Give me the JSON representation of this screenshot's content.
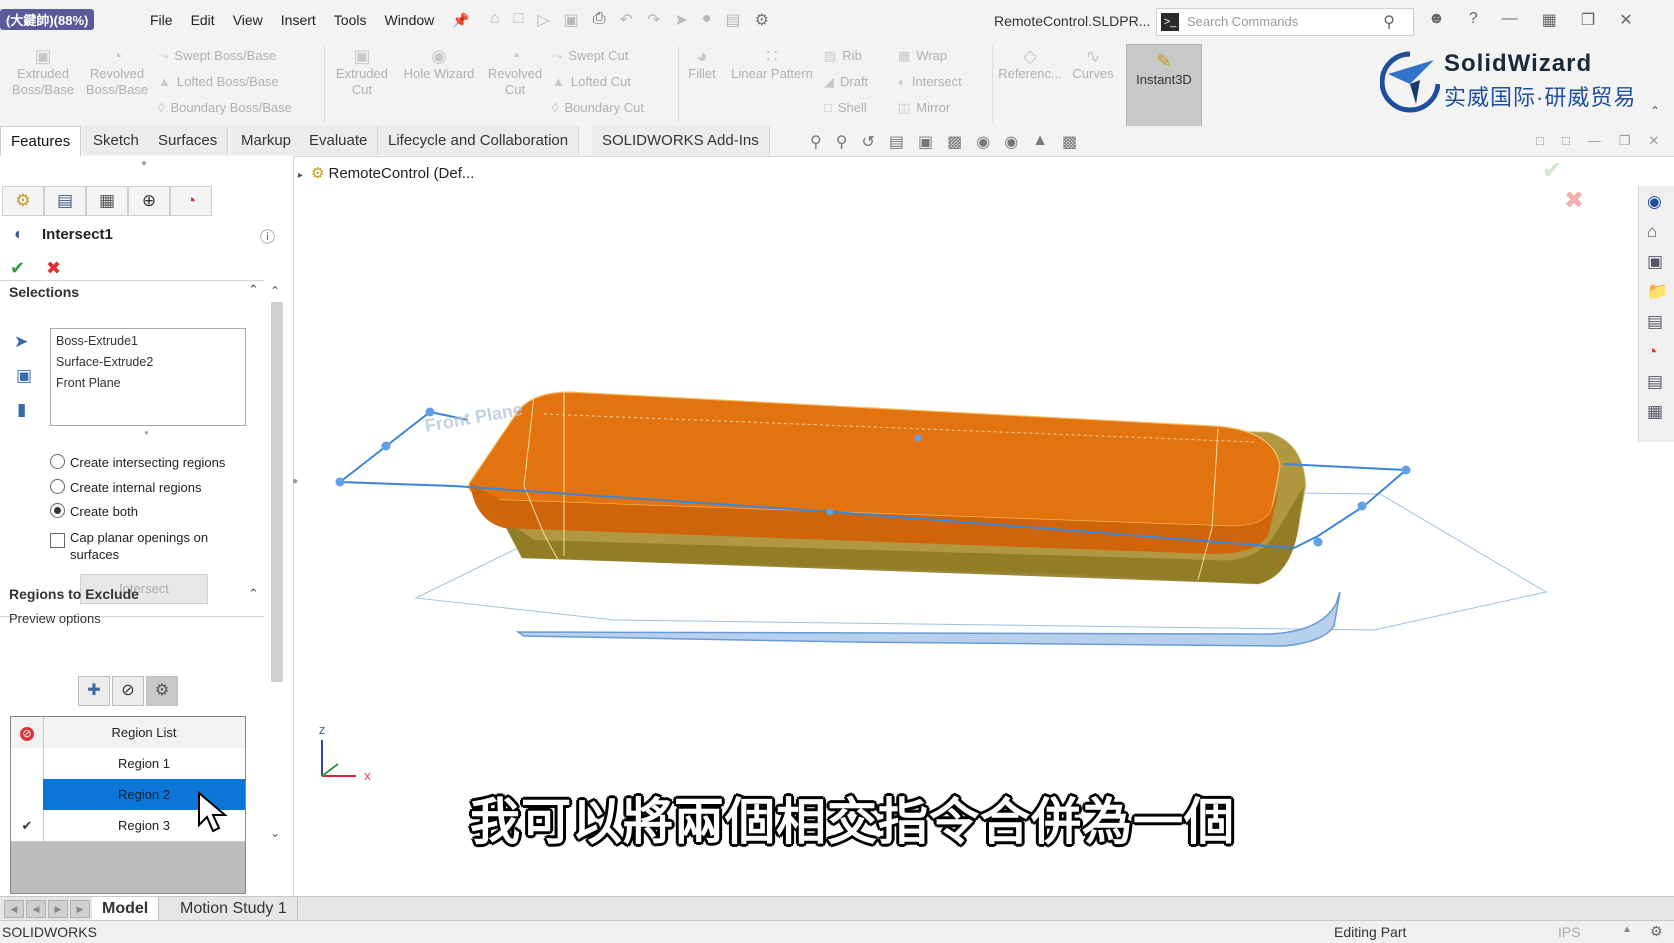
{
  "menubar": {
    "badge": "(大鍵帥)(88%)",
    "menus": [
      "File",
      "Edit",
      "View",
      "Insert",
      "Tools",
      "Window"
    ],
    "document_title": "RemoteControl.SLDPR...",
    "search_placeholder": "Search Commands"
  },
  "command_manager": {
    "tools": {
      "extruded_boss": "Extruded Boss/Base",
      "revolved_boss": "Revolved Boss/Base",
      "swept_boss": "Swept Boss/Base",
      "lofted_boss": "Lofted Boss/Base",
      "boundary_boss": "Boundary Boss/Base",
      "extruded_cut": "Extruded Cut",
      "hole_wizard": "Hole Wizard",
      "revolved_cut": "Revolved Cut",
      "swept_cut": "Swept Cut",
      "lofted_cut": "Lofted Cut",
      "boundary_cut": "Boundary Cut",
      "fillet": "Fillet",
      "linear_pattern": "Linear Pattern",
      "rib": "Rib",
      "draft": "Draft",
      "shell": "Shell",
      "wrap": "Wrap",
      "intersect": "Intersect",
      "mirror": "Mirror",
      "reference": "Referenc...",
      "curves": "Curves",
      "instant3d": "Instant3D"
    },
    "logo": {
      "brand": "SolidWizard",
      "subtitle": "实威国际·研威贸易"
    }
  },
  "tabs": [
    "Features",
    "Sketch",
    "Surfaces",
    "Markup",
    "Evaluate",
    "Lifecycle and Collaboration",
    "SOLIDWORKS Add-Ins"
  ],
  "feature_tree": {
    "root": "RemoteControl (Def..."
  },
  "property_manager": {
    "title": "Intersect1",
    "selections_header": "Selections",
    "selections": [
      "Boss-Extrude1",
      "Surface-Extrude2",
      "Front Plane"
    ],
    "options": [
      {
        "label": "Create intersecting regions",
        "checked": false
      },
      {
        "label": "Create internal regions",
        "checked": false
      },
      {
        "label": "Create both",
        "checked": true
      }
    ],
    "cap_label": "Cap planar openings on surfaces",
    "intersect_button": "Intersect",
    "regions_header": "Regions to Exclude",
    "preview_label": "Preview options",
    "region_list_header": "Region List",
    "regions": [
      {
        "label": "Region   1",
        "checked": false,
        "selected": false
      },
      {
        "label": "Region   2",
        "checked": false,
        "selected": true
      },
      {
        "label": "Region   3",
        "checked": true,
        "selected": false
      }
    ]
  },
  "viewport": {
    "plane_label": "Front Plane",
    "axis_z": "Z",
    "axis_x": "X",
    "subtitle": "我可以將兩個相交指令合併為一個"
  },
  "bottom_tabs": [
    "Model",
    "Motion Study 1"
  ],
  "status": {
    "app": "SOLIDWORKS",
    "mode": "Editing Part",
    "units": "IPS"
  },
  "colors": {
    "accent": "#0b76d8",
    "solid_top": "#e3730f",
    "solid_side": "#a08a2a",
    "plane": "#3b86d8"
  }
}
